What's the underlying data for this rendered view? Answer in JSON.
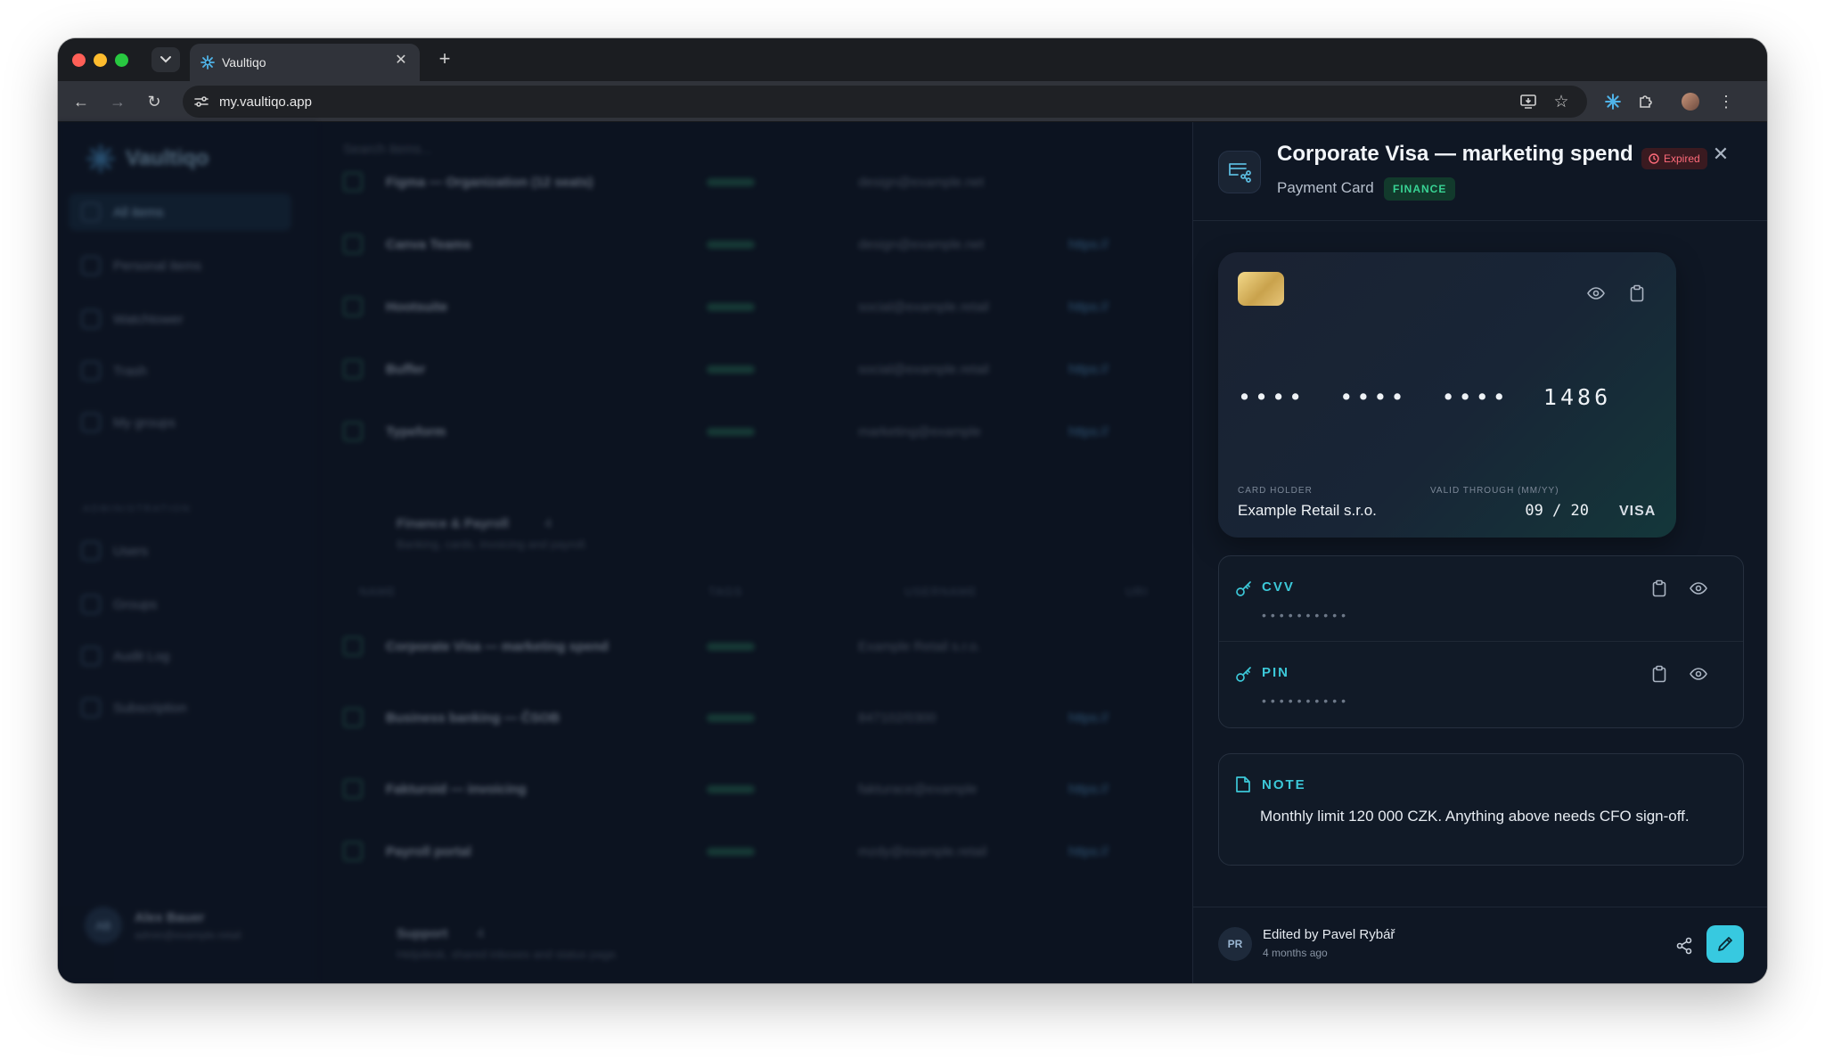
{
  "browser": {
    "tab_title": "Vaultiqo",
    "url": "my.vaultiqo.app"
  },
  "app": {
    "logo": "Vaultiqo",
    "search_placeholder": "Search items...",
    "sidebar": {
      "items": [
        {
          "label": "All items"
        },
        {
          "label": "Personal items"
        },
        {
          "label": "Watchtower"
        },
        {
          "label": "Trash"
        },
        {
          "label": "My groups"
        }
      ],
      "admin_label": "ADMINISTRATION",
      "admin_items": [
        {
          "label": "Users"
        },
        {
          "label": "Groups"
        },
        {
          "label": "Audit Log"
        },
        {
          "label": "Subscription"
        }
      ],
      "user": {
        "initials": "AB",
        "name": "Alex Bauer",
        "email": "admin@example.retail"
      }
    },
    "list": {
      "rows_top": [
        {
          "name": "Figma — Organization (12 seats)",
          "user": "design@example.net",
          "uri": ""
        },
        {
          "name": "Canva Teams",
          "user": "design@example.net",
          "uri": "https://"
        },
        {
          "name": "Hootsuite",
          "user": "social@example.retail",
          "uri": "https://"
        },
        {
          "name": "Buffer",
          "user": "social@example.retail",
          "uri": "https://"
        },
        {
          "name": "Typeform",
          "user": "marketing@example",
          "uri": "https://"
        }
      ],
      "group_finance": {
        "title": "Finance & Payroll",
        "count": "4",
        "desc": "Banking, cards, invoicing and payroll."
      },
      "columns": {
        "name": "NAME",
        "tags": "TAGS",
        "username": "USERNAME",
        "uri": "URI"
      },
      "rows_finance": [
        {
          "name": "Corporate Visa — marketing spend",
          "user": "Example Retail s.r.o.",
          "uri": ""
        },
        {
          "name": "Business banking — ČSOB",
          "user": "847102/0300",
          "uri": "https://"
        },
        {
          "name": "Fakturoid — invoicing",
          "user": "fakturace@example",
          "uri": "https://"
        },
        {
          "name": "Payroll portal",
          "user": "mzdy@example.retail",
          "uri": "https://"
        }
      ],
      "group_support": {
        "title": "Support",
        "count": "4",
        "desc": "Helpdesk, shared inboxes and status page."
      }
    },
    "detail": {
      "title": "Corporate Visa — marketing spend",
      "status_badge": "Expired",
      "type": "Payment Card",
      "tag": "FINANCE",
      "card": {
        "number_masked": "••••  ••••  ••••  1486",
        "holder_label": "CARD HOLDER",
        "holder": "Example Retail s.r.o.",
        "valid_label": "VALID THROUGH (MM/YY)",
        "valid": "09 / 20",
        "brand": "VISA"
      },
      "cvv": {
        "label": "CVV",
        "value_masked": "••••••••••"
      },
      "pin": {
        "label": "PIN",
        "value_masked": "••••••••••"
      },
      "note": {
        "label": "NOTE",
        "text": "Monthly limit 120 000 CZK. Anything above needs CFO sign-off."
      },
      "footer": {
        "initials": "PR",
        "edited_by": "Edited by Pavel Rybář",
        "time": "4 months ago"
      }
    }
  },
  "colors": {
    "accent": "#37c9e0",
    "expired": "#ff6b7a",
    "finance": "#38d394",
    "chip": "#d9b864"
  }
}
